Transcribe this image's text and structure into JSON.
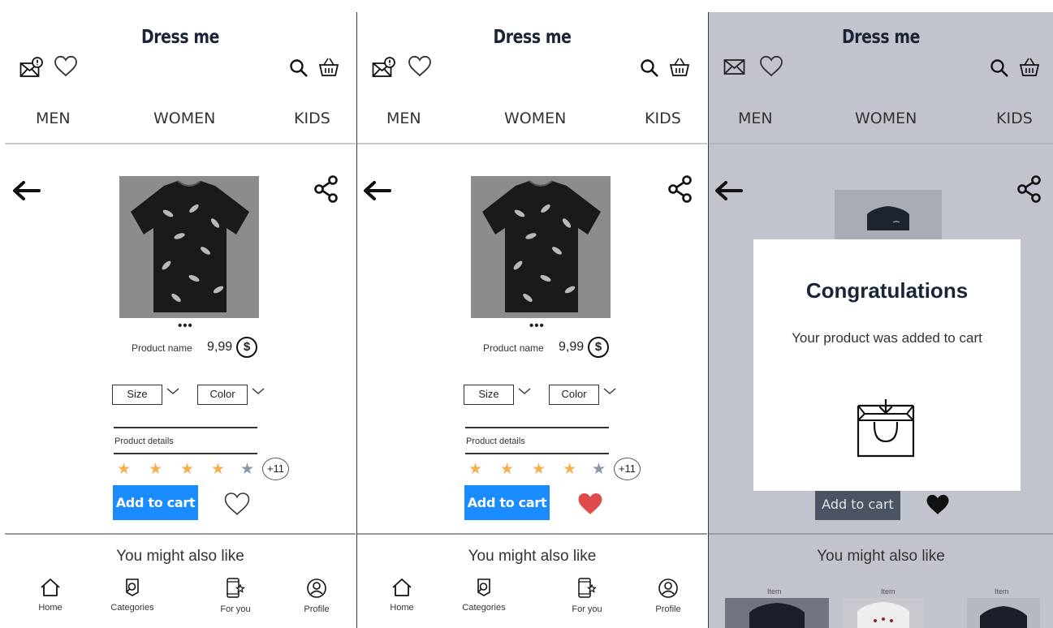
{
  "app": {
    "title": "Dress me"
  },
  "nav": {
    "men": "MEN",
    "women": "WOMEN",
    "kids": "KIDS"
  },
  "product": {
    "name": "Product name",
    "price": "9,99",
    "currency_symbol": "$",
    "carousel_indicator": "•••",
    "size_label": "Size",
    "color_label": "Color",
    "details_label": "Product details",
    "rating": 4,
    "rating_max": 5,
    "review_count": "+11"
  },
  "actions": {
    "add_to_cart": "Add to cart"
  },
  "recommendations": {
    "heading": "You might also like",
    "item_label": "Item"
  },
  "tabbar": {
    "home": "Home",
    "categories": "Categories",
    "for_you": "For you",
    "profile": "Profile"
  },
  "modal": {
    "title": "Congratulations",
    "message": "Your product was added to cart"
  },
  "colors": {
    "accent": "#1a8cff",
    "star": "#f2b150",
    "heart_filled": "#e04a4a",
    "overlay": "#c1c4cc",
    "disabled_button": "#4a5463"
  },
  "icons": [
    "mail-alert-icon",
    "heart-icon",
    "search-icon",
    "basket-icon",
    "back-arrow-icon",
    "share-icon",
    "dollar-coin-icon",
    "chevron-down-icon",
    "star-icon",
    "home-icon",
    "categories-icon",
    "for-you-icon",
    "profile-icon",
    "shopping-bag-icon"
  ]
}
